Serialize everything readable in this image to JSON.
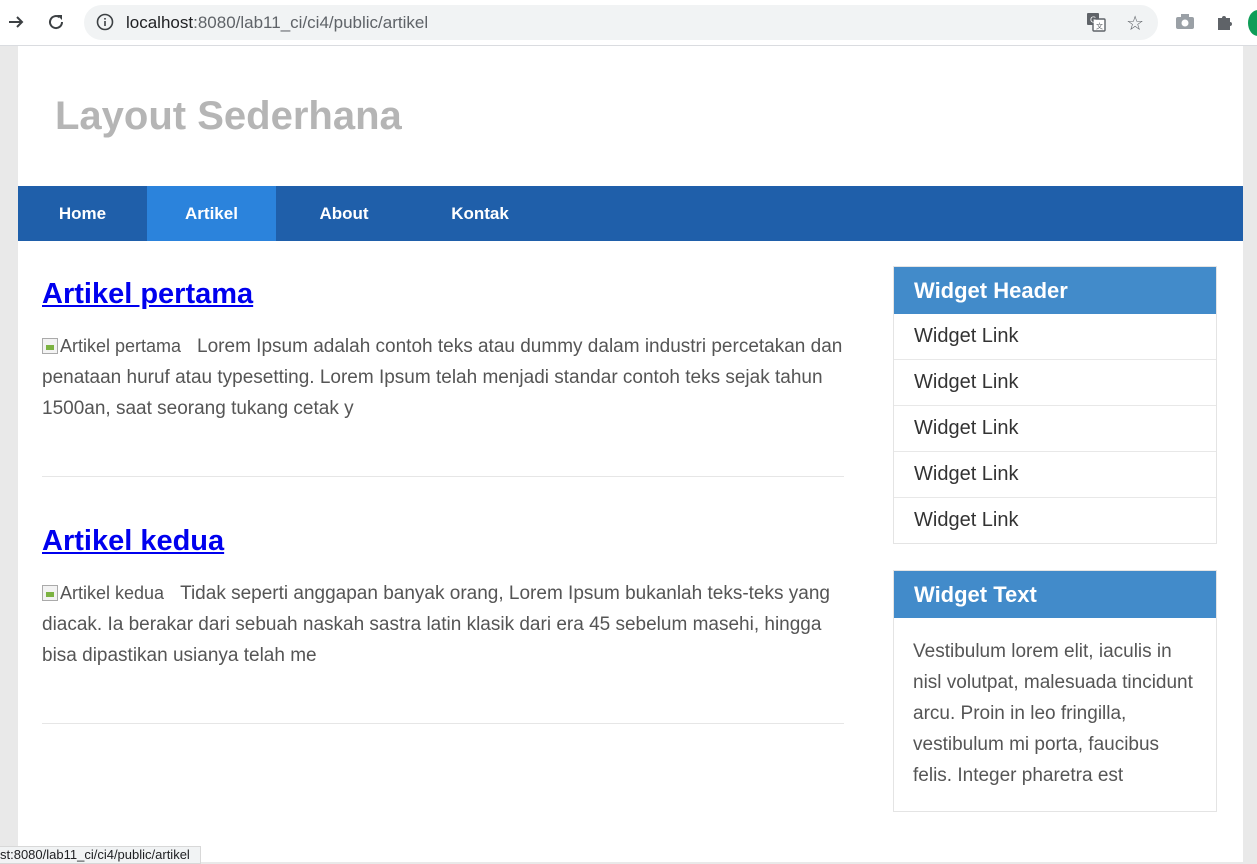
{
  "browser": {
    "url_host": "localhost",
    "url_path": ":8080/lab11_ci/ci4/public/artikel",
    "status_url": "st:8080/lab11_ci/ci4/public/artikel"
  },
  "site": {
    "title": "Layout Sederhana"
  },
  "nav": {
    "items": [
      {
        "label": "Home"
      },
      {
        "label": "Artikel"
      },
      {
        "label": "About"
      },
      {
        "label": "Kontak"
      }
    ],
    "active": "Artikel"
  },
  "articles": [
    {
      "title": "Artikel pertama",
      "image_alt": "Artikel pertama",
      "body": "Lorem Ipsum adalah contoh teks atau dummy dalam industri percetakan dan penataan huruf atau typesetting. Lorem Ipsum telah menjadi standar contoh teks sejak tahun 1500an, saat seorang tukang cetak y"
    },
    {
      "title": "Artikel kedua",
      "image_alt": "Artikel kedua",
      "body": "Tidak seperti anggapan banyak orang, Lorem Ipsum bukanlah teks-teks yang diacak. Ia berakar dari sebuah naskah sastra latin klasik dari era 45 sebelum masehi, hingga bisa dipastikan usianya telah me"
    }
  ],
  "sidebar": {
    "widget_links": {
      "header": "Widget Header",
      "links": [
        "Widget Link",
        "Widget Link",
        "Widget Link",
        "Widget Link",
        "Widget Link"
      ]
    },
    "widget_text": {
      "header": "Widget Text",
      "text": "Vestibulum lorem elit, iaculis in nisl volutpat, malesuada tincidunt arcu. Proin in leo fringilla, vestibulum mi porta, faucibus felis. Integer pharetra est"
    }
  },
  "colors": {
    "nav_bg": "#1f5faa",
    "nav_active": "#2b83dc",
    "widget_head": "#428bca",
    "link": "#0000ee",
    "title_gray": "#b5b5b5"
  }
}
